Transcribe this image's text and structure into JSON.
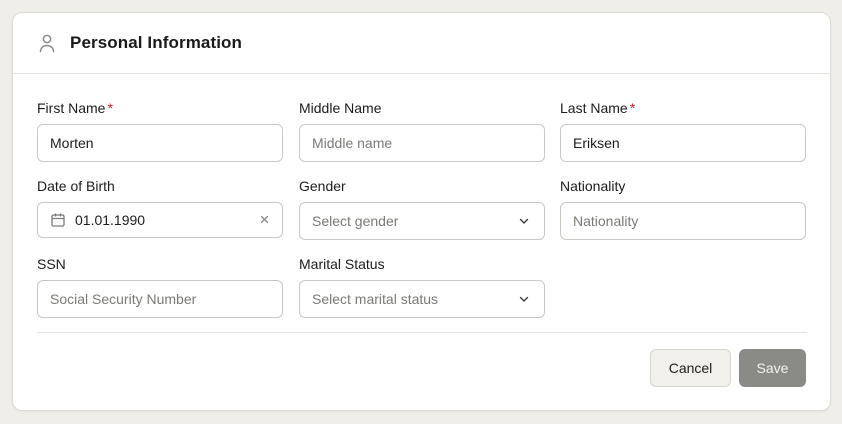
{
  "header": {
    "title": "Personal Information",
    "icon": "user-icon"
  },
  "fields": {
    "first_name": {
      "label": "First Name",
      "required": "*",
      "value": "Morten"
    },
    "middle_name": {
      "label": "Middle Name",
      "placeholder": "Middle name"
    },
    "last_name": {
      "label": "Last Name",
      "required": "*",
      "value": "Eriksen"
    },
    "dob": {
      "label": "Date of Birth",
      "value": "01.01.1990"
    },
    "gender": {
      "label": "Gender",
      "placeholder": "Select gender"
    },
    "nationality": {
      "label": "Nationality",
      "placeholder": "Nationality"
    },
    "ssn": {
      "label": "SSN",
      "placeholder": "Social Security Number"
    },
    "marital_status": {
      "label": "Marital Status",
      "placeholder": "Select marital status"
    }
  },
  "actions": {
    "cancel_label": "Cancel",
    "save_label": "Save"
  },
  "colors": {
    "required": "#d81b1b",
    "save_disabled": "#8a8a87",
    "background": "#efeee9"
  }
}
